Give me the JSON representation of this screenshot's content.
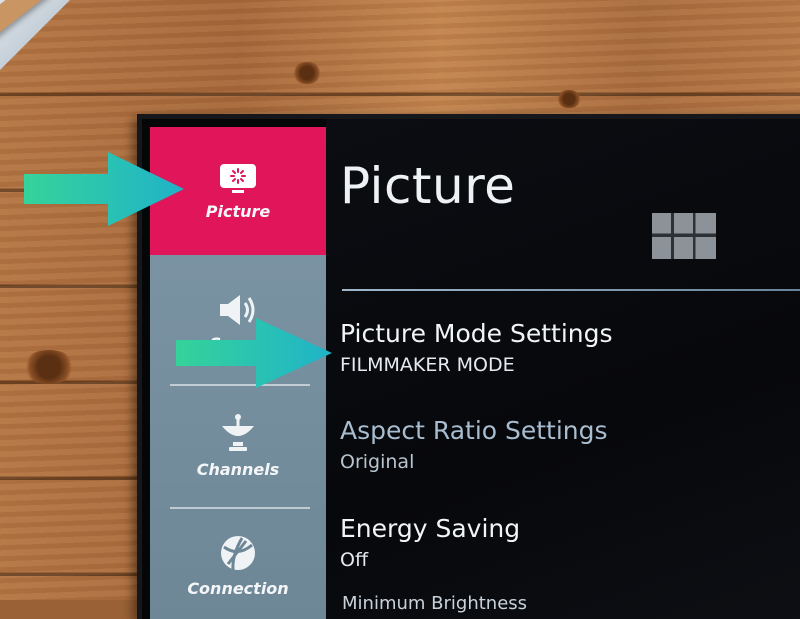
{
  "sidebar": {
    "items": [
      {
        "label": "Picture",
        "icon": "picture-icon",
        "active": true
      },
      {
        "label": "Sound",
        "icon": "speaker-icon",
        "active": false
      },
      {
        "label": "Channels",
        "icon": "satellite-dish-icon",
        "active": false
      },
      {
        "label": "Connection",
        "icon": "globe-icon",
        "active": false
      }
    ]
  },
  "main": {
    "title": "Picture",
    "settings": [
      {
        "name": "Picture Mode Settings",
        "value": "FILMMAKER MODE"
      },
      {
        "name": "Aspect Ratio Settings",
        "value": "Original"
      },
      {
        "name": "Energy Saving",
        "value": "Off"
      }
    ],
    "partial_item": "Minimum Brightness"
  },
  "colors": {
    "accent": "#e0155a",
    "arrow": "#2ec4b0",
    "panel": "#07080b"
  }
}
